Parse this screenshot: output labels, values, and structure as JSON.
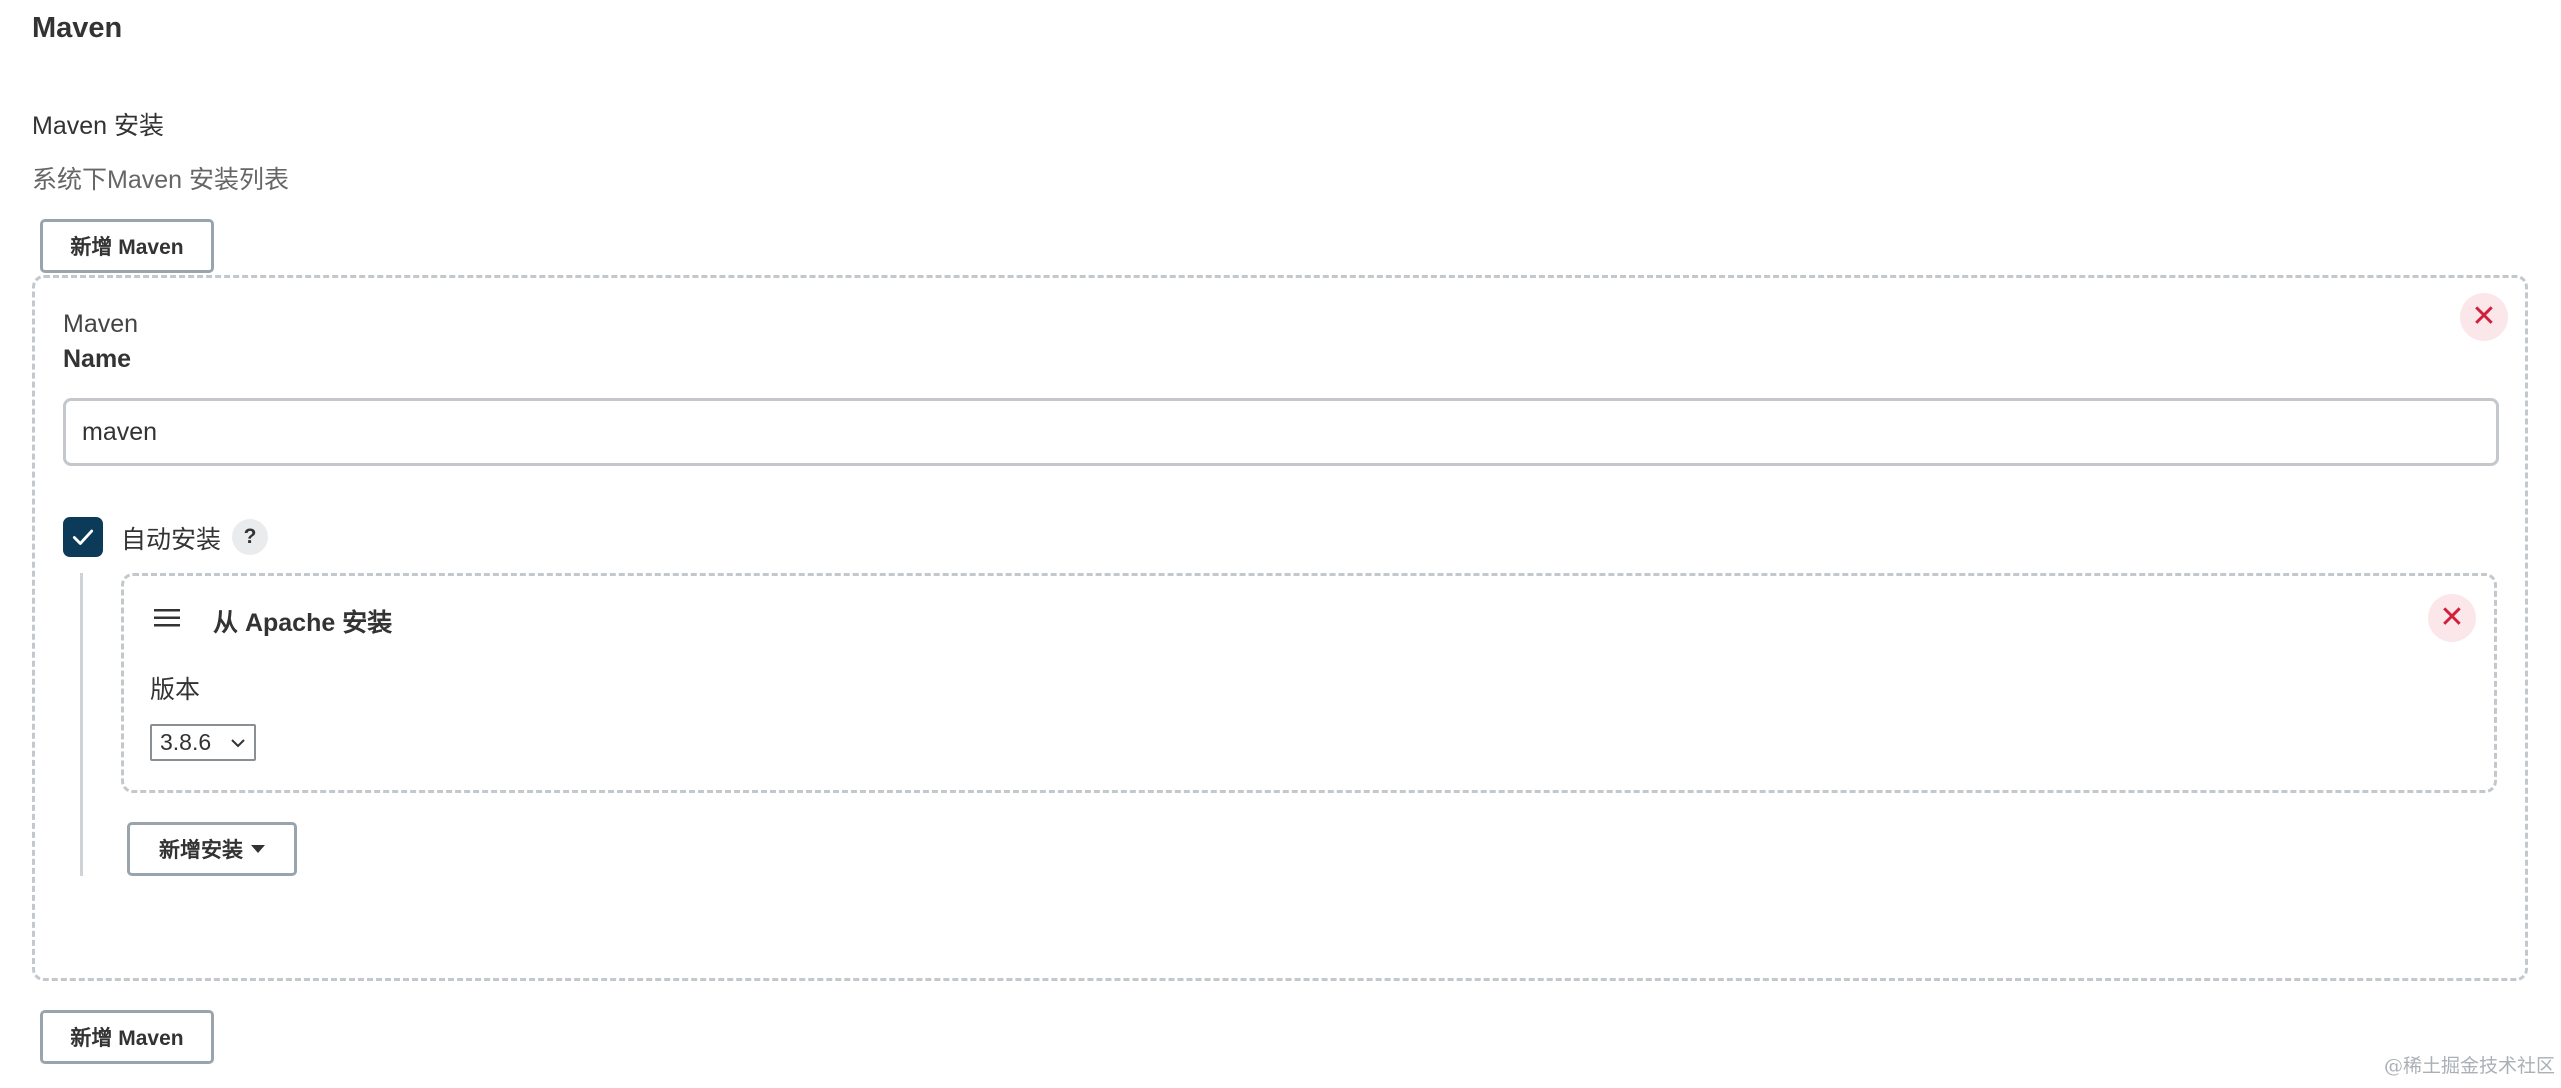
{
  "section": {
    "title": "Maven",
    "field_label": "Maven 安装",
    "field_description": "系统下Maven 安装列表",
    "add_button_label": "新增 Maven"
  },
  "installation": {
    "caption": "Maven",
    "name_label": "Name",
    "name_value": "maven",
    "auto_install": {
      "label": "自动安装",
      "checked": true,
      "help_label": "?"
    },
    "installer": {
      "title": "从 Apache 安装",
      "version_label": "版本",
      "version_selected": "3.8.6"
    },
    "add_installer_label": "新增安装",
    "close_glyph": "✕"
  },
  "watermark": "@稀土掘金技术社区",
  "colors": {
    "checkbox_fill": "#0c3b5a",
    "close_icon": "#d21f3c",
    "close_bg": "#fbe7ea",
    "dashed_border": "#c3c8cc"
  },
  "icons": [
    "close-icon",
    "check-icon",
    "help-icon",
    "drag-handle-icon",
    "chevron-down-icon",
    "caret-down-icon"
  ]
}
